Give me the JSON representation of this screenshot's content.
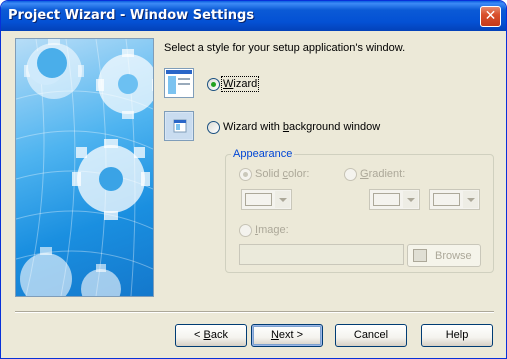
{
  "window": {
    "title": "Project Wizard - Window Settings"
  },
  "titlebar": {
    "close_glyph": "✕"
  },
  "main": {
    "heading": "Select a style for your setup application's window.",
    "options": [
      {
        "pre": "",
        "key": "W",
        "post": "izard",
        "selected": true,
        "icon": "wizard-preview-icon"
      },
      {
        "pre": "Wizard with ",
        "key": "b",
        "post": "ackground window",
        "selected": false,
        "icon": "wizard-background-preview-icon"
      }
    ]
  },
  "appearance": {
    "title": "Appearance",
    "solid_color": {
      "pre": "Solid ",
      "key": "c",
      "post": "olor:",
      "selected": true
    },
    "gradient": {
      "pre": "",
      "key": "G",
      "post": "radient:",
      "selected": false
    },
    "image": {
      "pre": "",
      "key": "I",
      "post": "mage:",
      "selected": false,
      "value": ""
    },
    "browse_label": "Browse"
  },
  "footer": {
    "back": {
      "pre": "< ",
      "key": "B",
      "post": "ack"
    },
    "next": {
      "pre": "",
      "key": "N",
      "post": "ext >"
    },
    "cancel": "Cancel",
    "help": "Help"
  },
  "colors": {
    "titlebar": "#0451d4",
    "dialog": "#ece9d8",
    "group_title": "#0046d5",
    "radio_selected": "#21a121"
  }
}
